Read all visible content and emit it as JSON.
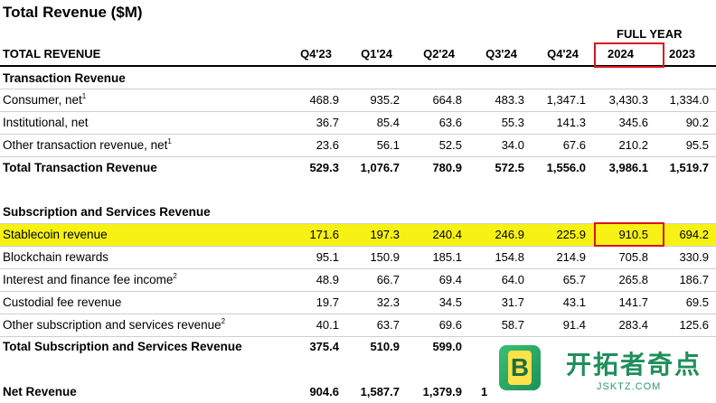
{
  "title": "Total Revenue ($M)",
  "full_year_label": "FULL YEAR",
  "header": {
    "label": "TOTAL REVENUE",
    "columns": [
      "Q4'23",
      "Q1'24",
      "Q2'24",
      "Q3'24",
      "Q4'24",
      "2024",
      "2023"
    ]
  },
  "sections": {
    "transaction": {
      "title": "Transaction Revenue",
      "rows": [
        {
          "label": "Consumer, net",
          "sup": "1",
          "values": [
            "468.9",
            "935.2",
            "664.8",
            "483.3",
            "1,347.1",
            "3,430.3",
            "1,334.0"
          ]
        },
        {
          "label": "Institutional, net",
          "sup": "",
          "values": [
            "36.7",
            "85.4",
            "63.6",
            "55.3",
            "141.3",
            "345.6",
            "90.2"
          ]
        },
        {
          "label": "Other transaction revenue, net",
          "sup": "1",
          "values": [
            "23.6",
            "56.1",
            "52.5",
            "34.0",
            "67.6",
            "210.2",
            "95.5"
          ]
        }
      ],
      "total": {
        "label": "Total Transaction Revenue",
        "values": [
          "529.3",
          "1,076.7",
          "780.9",
          "572.5",
          "1,556.0",
          "3,986.1",
          "1,519.7"
        ]
      }
    },
    "subscription": {
      "title": "Subscription and Services Revenue",
      "rows": [
        {
          "label": "Stablecoin revenue",
          "sup": "",
          "values": [
            "171.6",
            "197.3",
            "240.4",
            "246.9",
            "225.9",
            "910.5",
            "694.2"
          ]
        },
        {
          "label": "Blockchain rewards",
          "sup": "",
          "values": [
            "95.1",
            "150.9",
            "185.1",
            "154.8",
            "214.9",
            "705.8",
            "330.9"
          ]
        },
        {
          "label": "Interest and finance fee income",
          "sup": "2",
          "values": [
            "48.9",
            "66.7",
            "69.4",
            "64.0",
            "65.7",
            "265.8",
            "186.7"
          ]
        },
        {
          "label": "Custodial fee revenue",
          "sup": "",
          "values": [
            "19.7",
            "32.3",
            "34.5",
            "31.7",
            "43.1",
            "141.7",
            "69.5"
          ]
        },
        {
          "label": "Other subscription and services revenue",
          "sup": "2",
          "values": [
            "40.1",
            "63.7",
            "69.6",
            "58.7",
            "91.4",
            "283.4",
            "125.6"
          ]
        }
      ],
      "total": {
        "label": "Total Subscription and Services Revenue",
        "values": [
          "375.4",
          "510.9",
          "599.0",
          "",
          "",
          "",
          ""
        ]
      }
    }
  },
  "net_revenue": {
    "label": "Net Revenue",
    "values": [
      "904.6",
      "1,587.7",
      "1,379.9",
      "1",
      "",
      "",
      ""
    ]
  },
  "watermark": {
    "letter": "B",
    "text": "开拓者奇点",
    "url": "JSKTZ.COM"
  },
  "colors": {
    "highlight": "#f7f214",
    "box": "#d9151b",
    "watermark": "#1f8f5a"
  }
}
